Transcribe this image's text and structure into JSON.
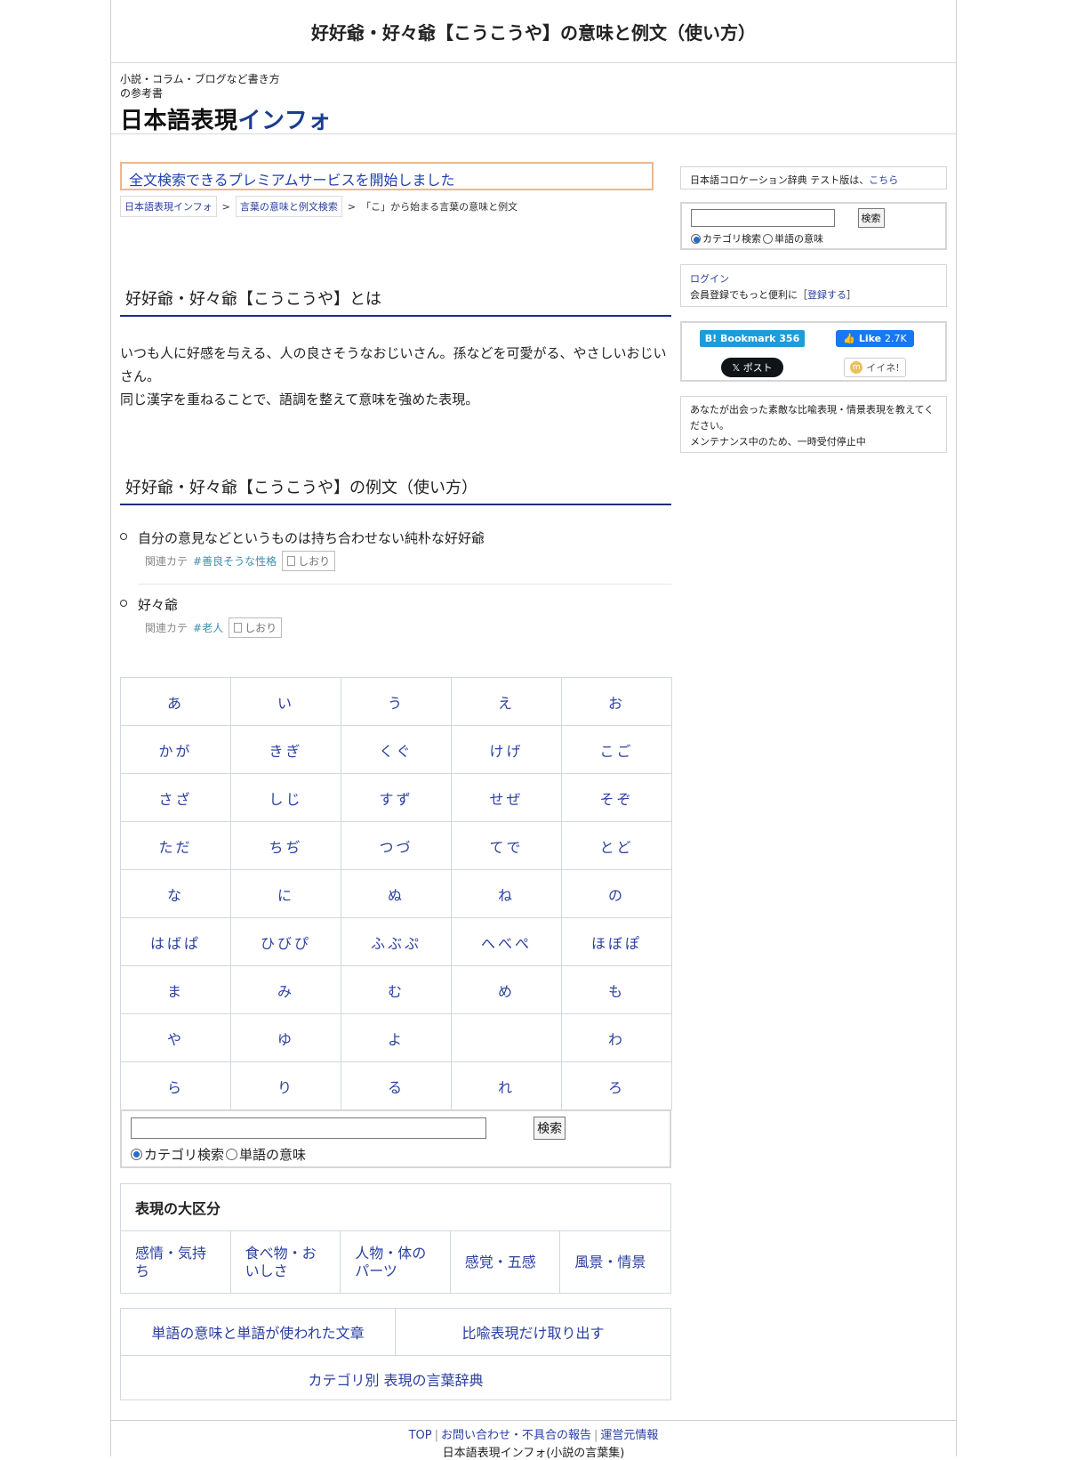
{
  "header": {
    "title": "好好爺・好々爺【こうこうや】の意味と例文（使い方）",
    "tagline": "小説・コラム・ブログなど書き方の参考書",
    "logo_part1": "日本語表現",
    "logo_part2": "インフォ"
  },
  "main": {
    "premium_notice": "全文検索できるプレミアムサービスを開始しました",
    "breadcrumb": [
      "日本語表現インフォ",
      "言葉の意味と例文検索",
      "「こ」から始まる言葉の意味と例文"
    ],
    "breadcrumb_separator": ">",
    "definition_heading": "好好爺・好々爺【こうこうや】とは",
    "definition_text_1": "いつも人に好感を与える、人の良さそうなおじいさん。孫などを可愛がる、やさしいおじいさん。",
    "definition_text_2": "同じ漢字を重ねることで、語調を整えて意味を強めた表現。",
    "examples_heading": "好好爺・好々爺【こうこうや】の例文（使い方）",
    "examples": [
      {
        "text": "自分の意見などというものは持ち合わせない純朴な好好爺",
        "meta_label": "関連カテ",
        "tag": "#善良そうな性格",
        "bookmark": "しおり"
      },
      {
        "text": "好々爺",
        "meta_label": "関連カテ",
        "tag": "#老人",
        "bookmark": "しおり"
      }
    ]
  },
  "kana": [
    "あ",
    "い",
    "う",
    "え",
    "お",
    "かが",
    "きぎ",
    "くぐ",
    "けげ",
    "こご",
    "さざ",
    "しじ",
    "すず",
    "せぜ",
    "そぞ",
    "ただ",
    "ちぢ",
    "つづ",
    "てで",
    "とど",
    "な",
    "に",
    "ぬ",
    "ね",
    "の",
    "はばぱ",
    "ひびぴ",
    "ふぶぷ",
    "へべぺ",
    "ほぼぽ",
    "ま",
    "み",
    "む",
    "め",
    "も",
    "や",
    "ゆ",
    "よ",
    "",
    "わ",
    "ら",
    "り",
    "る",
    "れ",
    "ろ"
  ],
  "search": {
    "button": "検索",
    "radio_category": "カテゴリ検索",
    "radio_word": "単語の意味",
    "selected": "カテゴリ検索"
  },
  "categories": {
    "heading": "表現の大区分",
    "items": [
      "感情・気持ち",
      "食べ物・おいしさ",
      "人物・体のパーツ",
      "感覚・五感",
      "風景・情景"
    ]
  },
  "links": {
    "words": "単語の意味と単語が使われた文章",
    "metaphor": "比喩表現だけ取り出す",
    "dictionary": "カテゴリ別 表現の言葉辞典"
  },
  "footer": {
    "nav": [
      "TOP",
      "お問い合わせ・不具合の報告",
      "運営元情報"
    ],
    "copyright": "日本語表現インフォ(小説の言葉集)"
  },
  "sidebar": {
    "collocation_text": "日本語コロケーション辞典 テスト版は、",
    "collocation_link": "こちら",
    "login": "ログイン",
    "register_text": "会員登録でもっと便利に［",
    "register_link": "登録する",
    "register_close": "］",
    "social": {
      "hatena": "B! Bookmark 356",
      "fb_like": "Like",
      "fb_count": "2.7K",
      "x_post": "ポスト",
      "mixi": "イイネ!"
    },
    "request_text": "あなたが出会った素敵な比喩表現・情景表現を教えてください。",
    "maintenance_text": "メンテナンス中のため、一時受付停止中"
  },
  "colors": {
    "link": "#2a3fa0",
    "heading_rule": "#1a2f78",
    "premium_border": "#e9b98f",
    "grid_border": "#cfd9e0"
  }
}
